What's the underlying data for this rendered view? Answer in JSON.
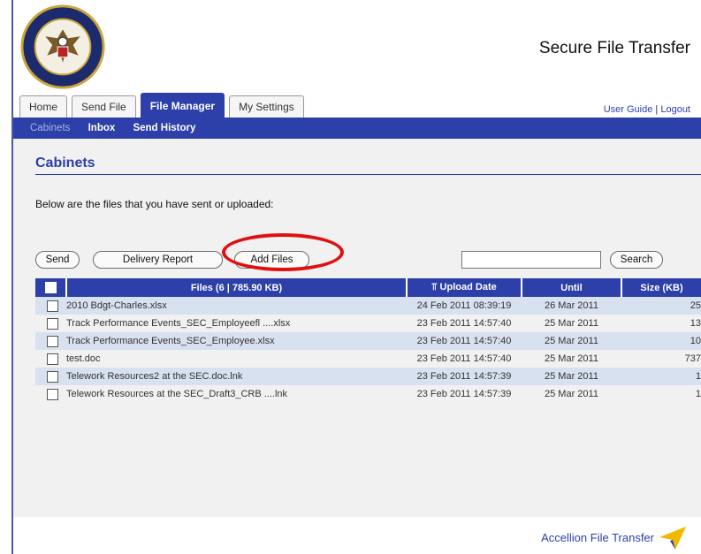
{
  "app": {
    "title": "Secure File Transfer"
  },
  "tabs": [
    {
      "label": "Home",
      "active": false
    },
    {
      "label": "Send File",
      "active": false
    },
    {
      "label": "File Manager",
      "active": true
    },
    {
      "label": "My Settings",
      "active": false
    }
  ],
  "top_links": {
    "guide": "User Guide",
    "separator": "|",
    "logout": "Logout"
  },
  "subnav": {
    "cabinets": "Cabinets",
    "inbox": "Inbox",
    "history": "Send History"
  },
  "page": {
    "title": "Cabinets",
    "description": "Below are the files that you have sent or uploaded:"
  },
  "toolbar": {
    "send": "Send",
    "delivery_report": "Delivery Report",
    "add_files": "Add Files",
    "search": "Search",
    "search_value": ""
  },
  "table": {
    "headers": {
      "files": "Files (6 | 785.90 KB)",
      "upload_date": "Upload Date",
      "sort_icon": "⫪",
      "until": "Until",
      "size": "Size (KB)"
    },
    "rows": [
      {
        "name": "2010 Bdgt-Charles.xlsx",
        "upload": "24 Feb 2011 08:39:19",
        "until": "26 Mar 2011",
        "size": "25"
      },
      {
        "name": "Track Performance Events_SEC_Employeefl ....xlsx",
        "upload": "23 Feb 2011 14:57:40",
        "until": "25 Mar 2011",
        "size": "13"
      },
      {
        "name": "Track Performance Events_SEC_Employee.xlsx",
        "upload": "23 Feb 2011 14:57:40",
        "until": "25 Mar 2011",
        "size": "10"
      },
      {
        "name": "test.doc",
        "upload": "23 Feb 2011 14:57:40",
        "until": "25 Mar 2011",
        "size": "737"
      },
      {
        "name": "Telework Resources2 at the SEC.doc.lnk",
        "upload": "23 Feb 2011 14:57:39",
        "until": "25 Mar 2011",
        "size": "1"
      },
      {
        "name": "Telework Resources at the SEC_Draft3_CRB ....lnk",
        "upload": "23 Feb 2011 14:57:39",
        "until": "25 Mar 2011",
        "size": "1"
      }
    ]
  },
  "footer": {
    "brand": "Accellion File Transfer"
  },
  "colors": {
    "accent": "#2d3fa8",
    "row_alt": "#d8e1f0",
    "content_bg": "#f1f1f1",
    "highlight": "#e01010"
  }
}
